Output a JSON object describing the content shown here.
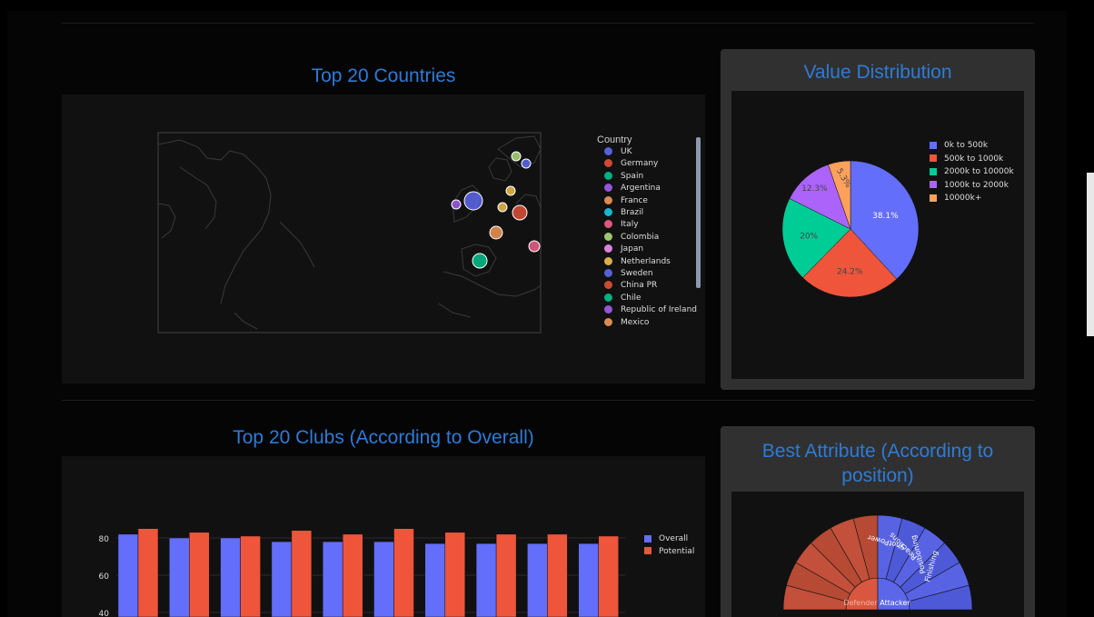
{
  "countries_chart": {
    "title": "Top 20 Countries",
    "legend_title": "Country",
    "items": [
      {
        "label": "UK",
        "color": "#636efa"
      },
      {
        "label": "Germany",
        "color": "#ef553b"
      },
      {
        "label": "Spain",
        "color": "#00cc96"
      },
      {
        "label": "Argentina",
        "color": "#ab63fa"
      },
      {
        "label": "France",
        "color": "#ffa15a"
      },
      {
        "label": "Brazil",
        "color": "#19d3f3"
      },
      {
        "label": "Italy",
        "color": "#ff6692"
      },
      {
        "label": "Colombia",
        "color": "#b6e880"
      },
      {
        "label": "Japan",
        "color": "#ff97ff"
      },
      {
        "label": "Netherlands",
        "color": "#fecb52"
      },
      {
        "label": "Sweden",
        "color": "#636efa"
      },
      {
        "label": "China PR",
        "color": "#ef553b"
      },
      {
        "label": "Chile",
        "color": "#00cc96"
      },
      {
        "label": "Republic of Ireland",
        "color": "#ab63fa"
      },
      {
        "label": "Mexico",
        "color": "#ffa15a"
      }
    ]
  },
  "value_chart": {
    "title": "Value Distribution",
    "legend": [
      {
        "label": "0k to 500k",
        "color": "#636efa"
      },
      {
        "label": "500k to 1000k",
        "color": "#ef553b"
      },
      {
        "label": "2000k to 10000k",
        "color": "#00cc96"
      },
      {
        "label": "1000k to 2000k",
        "color": "#ab63fa"
      },
      {
        "label": "10000k+",
        "color": "#ffa15a"
      }
    ]
  },
  "clubs_chart": {
    "title": "Top 20 Clubs (According to Overall)",
    "legend": [
      {
        "label": "Overall",
        "color": "#636efa"
      },
      {
        "label": "Potential",
        "color": "#ef553b"
      }
    ]
  },
  "attr_chart": {
    "title": "Best Attribute (According to position)",
    "inner_labels": [
      "Defender",
      "Attacker"
    ],
    "outer_labels": [
      "ShotPower",
      "Reactions",
      "Positioning",
      "Finishing"
    ]
  },
  "chart_data": [
    {
      "type": "pie",
      "title": "Value Distribution",
      "labels": [
        "0k to 500k",
        "500k to 1000k",
        "2000k to 10000k",
        "1000k to 2000k",
        "10000k+"
      ],
      "values": [
        38.1,
        24.2,
        20,
        12.3,
        5.3
      ],
      "value_labels": [
        "38.1%",
        "24.2%",
        "20%",
        "12.3%",
        "5.3%"
      ],
      "colors": [
        "#636efa",
        "#ef553b",
        "#00cc96",
        "#ab63fa",
        "#ffa15a"
      ],
      "legend": "top-right"
    },
    {
      "type": "bar",
      "title": "Top 20 Clubs (According to Overall)",
      "series": [
        {
          "name": "Overall",
          "values": [
            82,
            80,
            80,
            78,
            78,
            78,
            77,
            77,
            77,
            77
          ]
        },
        {
          "name": "Potential",
          "values": [
            85,
            83,
            81,
            84,
            82,
            85,
            83,
            82,
            82,
            81
          ]
        }
      ],
      "ylim": [
        40,
        90
      ],
      "yticks": [
        40,
        60,
        80
      ],
      "legend": "top-right"
    }
  ]
}
